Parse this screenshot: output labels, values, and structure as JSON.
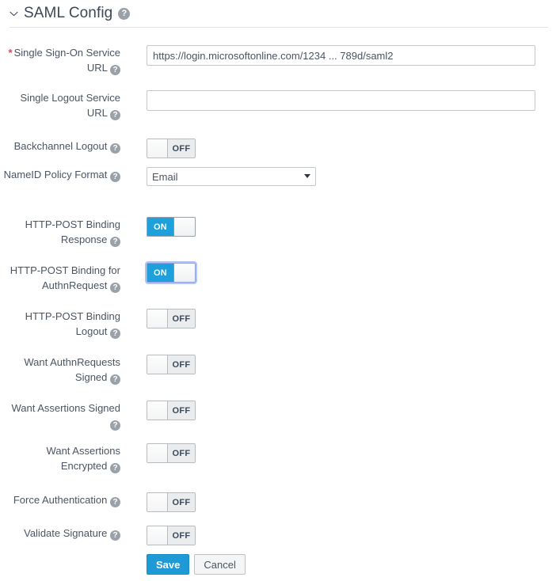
{
  "section": {
    "title": "SAML Config",
    "collapse_icon": "chevron-down-icon",
    "help_icon": "help-circle-icon",
    "help_glyph": "?"
  },
  "colors": {
    "accent": "#1fa0da",
    "primary_button": "#1e9bd7",
    "required_marker": "#d9455f",
    "label_text": "#4b5563",
    "title_text": "#3c4858",
    "input_border": "#c6c8ca",
    "toggle_off_bg": "#ebecee",
    "focus_ring": "#b9c4ee"
  },
  "labels": {
    "required_marker": "*",
    "toggle_on": "ON",
    "toggle_off": "OFF"
  },
  "fields": [
    {
      "id": "single-sign-on-service-url",
      "label": "Single Sign-On Service URL",
      "required": true,
      "type": "text",
      "value": "https://login.microsoftonline.com/1234 ... 789d/saml2",
      "placeholder": ""
    },
    {
      "id": "single-logout-service-url",
      "label": "Single Logout Service URL",
      "required": false,
      "type": "text",
      "value": "",
      "placeholder": ""
    },
    {
      "id": "backchannel-logout",
      "label": "Backchannel Logout",
      "required": false,
      "type": "toggle",
      "state": "OFF",
      "focused": false
    },
    {
      "id": "nameid-policy-format",
      "label": "NameID Policy Format",
      "required": false,
      "type": "select",
      "value": "Email",
      "options": [
        "Email"
      ]
    },
    {
      "id": "http-post-binding-response",
      "label": "HTTP-POST Binding Response",
      "required": false,
      "type": "toggle",
      "state": "ON",
      "focused": false
    },
    {
      "id": "http-post-binding-for-authnrequest",
      "label": "HTTP-POST Binding for AuthnRequest",
      "required": false,
      "type": "toggle",
      "state": "ON",
      "focused": true
    },
    {
      "id": "http-post-binding-logout",
      "label": "HTTP-POST Binding Logout",
      "required": false,
      "type": "toggle",
      "state": "OFF",
      "focused": false
    },
    {
      "id": "want-authnrequests-signed",
      "label": "Want AuthnRequests Signed",
      "required": false,
      "type": "toggle",
      "state": "OFF",
      "focused": false
    },
    {
      "id": "want-assertions-signed",
      "label": "Want Assertions Signed",
      "required": false,
      "type": "toggle",
      "state": "OFF",
      "focused": false
    },
    {
      "id": "want-assertions-encrypted",
      "label": "Want Assertions Encrypted",
      "required": false,
      "type": "toggle",
      "state": "OFF",
      "focused": false
    },
    {
      "id": "force-authentication",
      "label": "Force Authentication",
      "required": false,
      "type": "toggle",
      "state": "OFF",
      "focused": false
    },
    {
      "id": "validate-signature",
      "label": "Validate Signature",
      "required": false,
      "type": "toggle",
      "state": "OFF",
      "focused": false
    }
  ],
  "actions": {
    "save_label": "Save",
    "cancel_label": "Cancel"
  }
}
